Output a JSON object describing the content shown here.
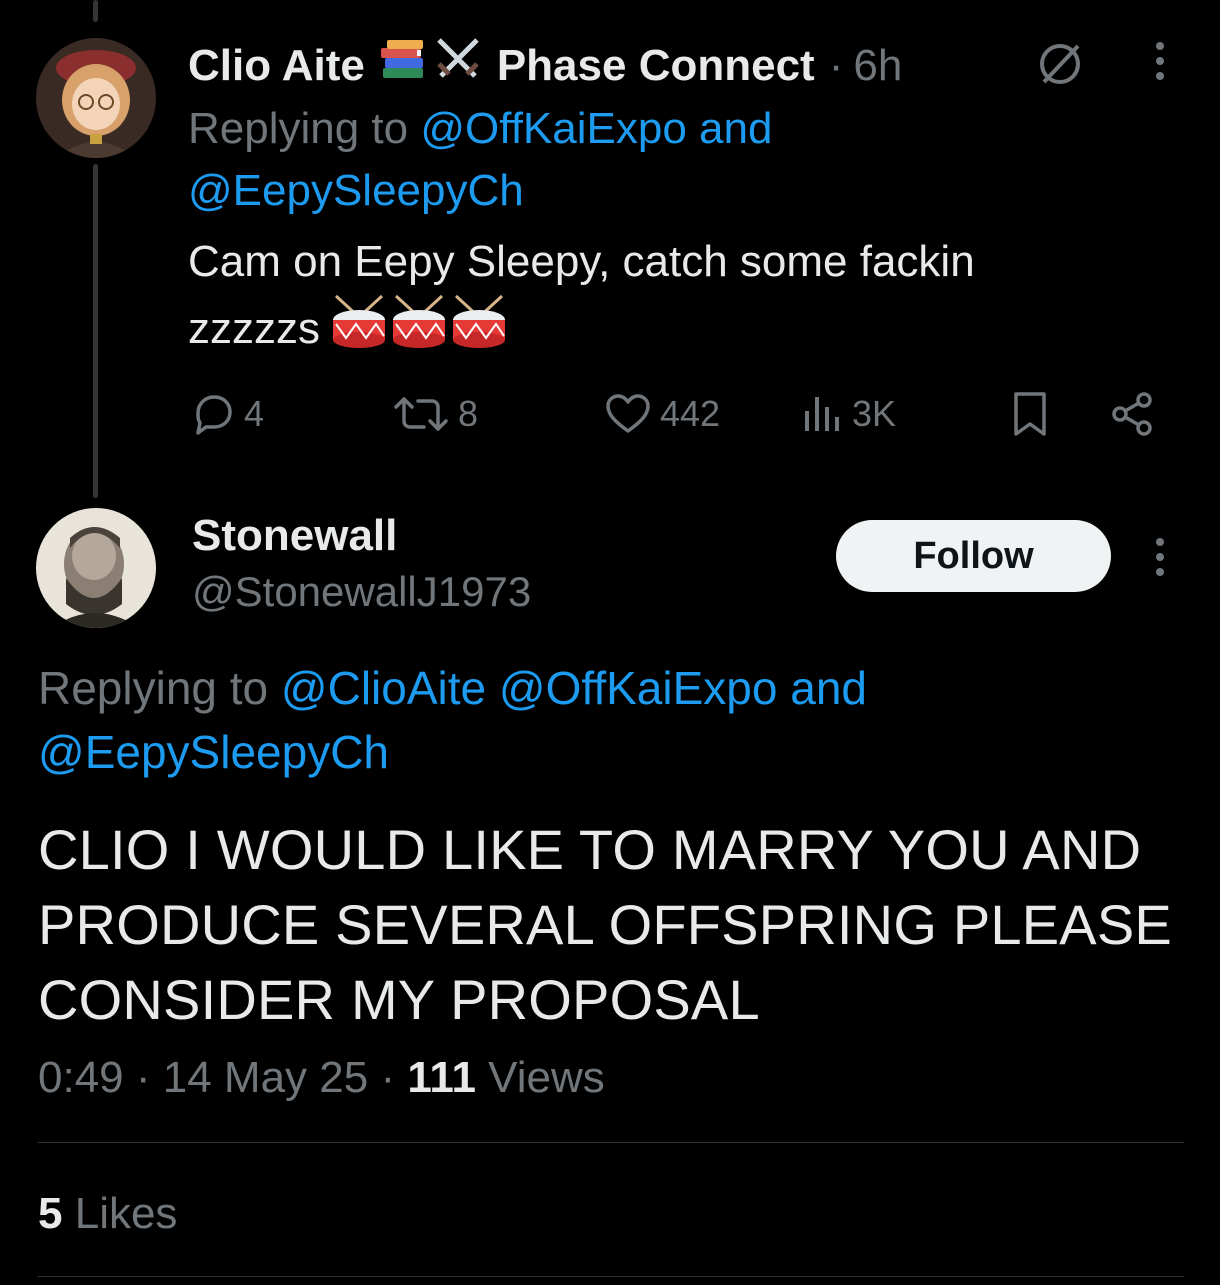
{
  "post1": {
    "author_name": "Clio Aite",
    "affiliation": "Phase Connect",
    "separator": "·",
    "time": "6h",
    "replying_prefix": "Replying to",
    "replying_to_1": "@OffKaiExpo",
    "replying_and": "and",
    "replying_to_2": "@EepySleepyCh",
    "text_line1": "Cam on Eepy Sleepy, catch some fackin",
    "text_line2": "zzzzzs",
    "stats": {
      "replies": "4",
      "reposts": "8",
      "likes": "442",
      "views": "3K"
    },
    "icons": [
      "books-emoji",
      "crossed-swords-emoji",
      "muted-icon",
      "more-icon",
      "drum-emoji",
      "reply-icon",
      "repost-icon",
      "like-icon",
      "views-icon",
      "bookmark-icon",
      "share-icon"
    ]
  },
  "post2": {
    "author_name": "Stonewall",
    "handle": "@StonewallJ1973",
    "follow_label": "Follow",
    "replying_prefix": "Replying to",
    "replying_to_1": "@ClioAite",
    "replying_to_2": "@OffKaiExpo",
    "replying_and": "and",
    "replying_to_3": "@EepySleepyCh",
    "text": "CLIO I WOULD LIKE TO MARRY YOU AND PRODUCE SEVERAL OFFSPRING PLEASE CONSIDER MY PROPOSAL",
    "time": "0:49",
    "date": "14 May 25",
    "dot": "·",
    "views_count": "111",
    "views_label": "Views",
    "likes_count": "5",
    "likes_label": "Likes"
  },
  "colors": {
    "background": "#000000",
    "text": "#e7e9ea",
    "muted": "#71767b",
    "link": "#1d9bf0",
    "divider": "#2f3336"
  }
}
